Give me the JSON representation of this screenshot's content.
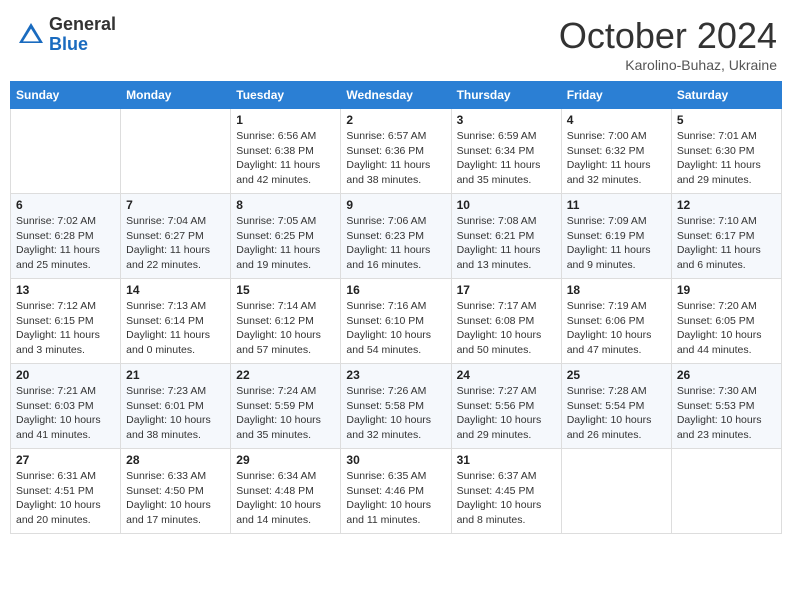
{
  "header": {
    "logo_general": "General",
    "logo_blue": "Blue",
    "month_title": "October 2024",
    "subtitle": "Karolino-Buhaz, Ukraine"
  },
  "weekdays": [
    "Sunday",
    "Monday",
    "Tuesday",
    "Wednesday",
    "Thursday",
    "Friday",
    "Saturday"
  ],
  "weeks": [
    [
      null,
      null,
      {
        "day": "1",
        "sunrise": "Sunrise: 6:56 AM",
        "sunset": "Sunset: 6:38 PM",
        "daylight": "Daylight: 11 hours and 42 minutes."
      },
      {
        "day": "2",
        "sunrise": "Sunrise: 6:57 AM",
        "sunset": "Sunset: 6:36 PM",
        "daylight": "Daylight: 11 hours and 38 minutes."
      },
      {
        "day": "3",
        "sunrise": "Sunrise: 6:59 AM",
        "sunset": "Sunset: 6:34 PM",
        "daylight": "Daylight: 11 hours and 35 minutes."
      },
      {
        "day": "4",
        "sunrise": "Sunrise: 7:00 AM",
        "sunset": "Sunset: 6:32 PM",
        "daylight": "Daylight: 11 hours and 32 minutes."
      },
      {
        "day": "5",
        "sunrise": "Sunrise: 7:01 AM",
        "sunset": "Sunset: 6:30 PM",
        "daylight": "Daylight: 11 hours and 29 minutes."
      }
    ],
    [
      {
        "day": "6",
        "sunrise": "Sunrise: 7:02 AM",
        "sunset": "Sunset: 6:28 PM",
        "daylight": "Daylight: 11 hours and 25 minutes."
      },
      {
        "day": "7",
        "sunrise": "Sunrise: 7:04 AM",
        "sunset": "Sunset: 6:27 PM",
        "daylight": "Daylight: 11 hours and 22 minutes."
      },
      {
        "day": "8",
        "sunrise": "Sunrise: 7:05 AM",
        "sunset": "Sunset: 6:25 PM",
        "daylight": "Daylight: 11 hours and 19 minutes."
      },
      {
        "day": "9",
        "sunrise": "Sunrise: 7:06 AM",
        "sunset": "Sunset: 6:23 PM",
        "daylight": "Daylight: 11 hours and 16 minutes."
      },
      {
        "day": "10",
        "sunrise": "Sunrise: 7:08 AM",
        "sunset": "Sunset: 6:21 PM",
        "daylight": "Daylight: 11 hours and 13 minutes."
      },
      {
        "day": "11",
        "sunrise": "Sunrise: 7:09 AM",
        "sunset": "Sunset: 6:19 PM",
        "daylight": "Daylight: 11 hours and 9 minutes."
      },
      {
        "day": "12",
        "sunrise": "Sunrise: 7:10 AM",
        "sunset": "Sunset: 6:17 PM",
        "daylight": "Daylight: 11 hours and 6 minutes."
      }
    ],
    [
      {
        "day": "13",
        "sunrise": "Sunrise: 7:12 AM",
        "sunset": "Sunset: 6:15 PM",
        "daylight": "Daylight: 11 hours and 3 minutes."
      },
      {
        "day": "14",
        "sunrise": "Sunrise: 7:13 AM",
        "sunset": "Sunset: 6:14 PM",
        "daylight": "Daylight: 11 hours and 0 minutes."
      },
      {
        "day": "15",
        "sunrise": "Sunrise: 7:14 AM",
        "sunset": "Sunset: 6:12 PM",
        "daylight": "Daylight: 10 hours and 57 minutes."
      },
      {
        "day": "16",
        "sunrise": "Sunrise: 7:16 AM",
        "sunset": "Sunset: 6:10 PM",
        "daylight": "Daylight: 10 hours and 54 minutes."
      },
      {
        "day": "17",
        "sunrise": "Sunrise: 7:17 AM",
        "sunset": "Sunset: 6:08 PM",
        "daylight": "Daylight: 10 hours and 50 minutes."
      },
      {
        "day": "18",
        "sunrise": "Sunrise: 7:19 AM",
        "sunset": "Sunset: 6:06 PM",
        "daylight": "Daylight: 10 hours and 47 minutes."
      },
      {
        "day": "19",
        "sunrise": "Sunrise: 7:20 AM",
        "sunset": "Sunset: 6:05 PM",
        "daylight": "Daylight: 10 hours and 44 minutes."
      }
    ],
    [
      {
        "day": "20",
        "sunrise": "Sunrise: 7:21 AM",
        "sunset": "Sunset: 6:03 PM",
        "daylight": "Daylight: 10 hours and 41 minutes."
      },
      {
        "day": "21",
        "sunrise": "Sunrise: 7:23 AM",
        "sunset": "Sunset: 6:01 PM",
        "daylight": "Daylight: 10 hours and 38 minutes."
      },
      {
        "day": "22",
        "sunrise": "Sunrise: 7:24 AM",
        "sunset": "Sunset: 5:59 PM",
        "daylight": "Daylight: 10 hours and 35 minutes."
      },
      {
        "day": "23",
        "sunrise": "Sunrise: 7:26 AM",
        "sunset": "Sunset: 5:58 PM",
        "daylight": "Daylight: 10 hours and 32 minutes."
      },
      {
        "day": "24",
        "sunrise": "Sunrise: 7:27 AM",
        "sunset": "Sunset: 5:56 PM",
        "daylight": "Daylight: 10 hours and 29 minutes."
      },
      {
        "day": "25",
        "sunrise": "Sunrise: 7:28 AM",
        "sunset": "Sunset: 5:54 PM",
        "daylight": "Daylight: 10 hours and 26 minutes."
      },
      {
        "day": "26",
        "sunrise": "Sunrise: 7:30 AM",
        "sunset": "Sunset: 5:53 PM",
        "daylight": "Daylight: 10 hours and 23 minutes."
      }
    ],
    [
      {
        "day": "27",
        "sunrise": "Sunrise: 6:31 AM",
        "sunset": "Sunset: 4:51 PM",
        "daylight": "Daylight: 10 hours and 20 minutes."
      },
      {
        "day": "28",
        "sunrise": "Sunrise: 6:33 AM",
        "sunset": "Sunset: 4:50 PM",
        "daylight": "Daylight: 10 hours and 17 minutes."
      },
      {
        "day": "29",
        "sunrise": "Sunrise: 6:34 AM",
        "sunset": "Sunset: 4:48 PM",
        "daylight": "Daylight: 10 hours and 14 minutes."
      },
      {
        "day": "30",
        "sunrise": "Sunrise: 6:35 AM",
        "sunset": "Sunset: 4:46 PM",
        "daylight": "Daylight: 10 hours and 11 minutes."
      },
      {
        "day": "31",
        "sunrise": "Sunrise: 6:37 AM",
        "sunset": "Sunset: 4:45 PM",
        "daylight": "Daylight: 10 hours and 8 minutes."
      },
      null,
      null
    ]
  ]
}
